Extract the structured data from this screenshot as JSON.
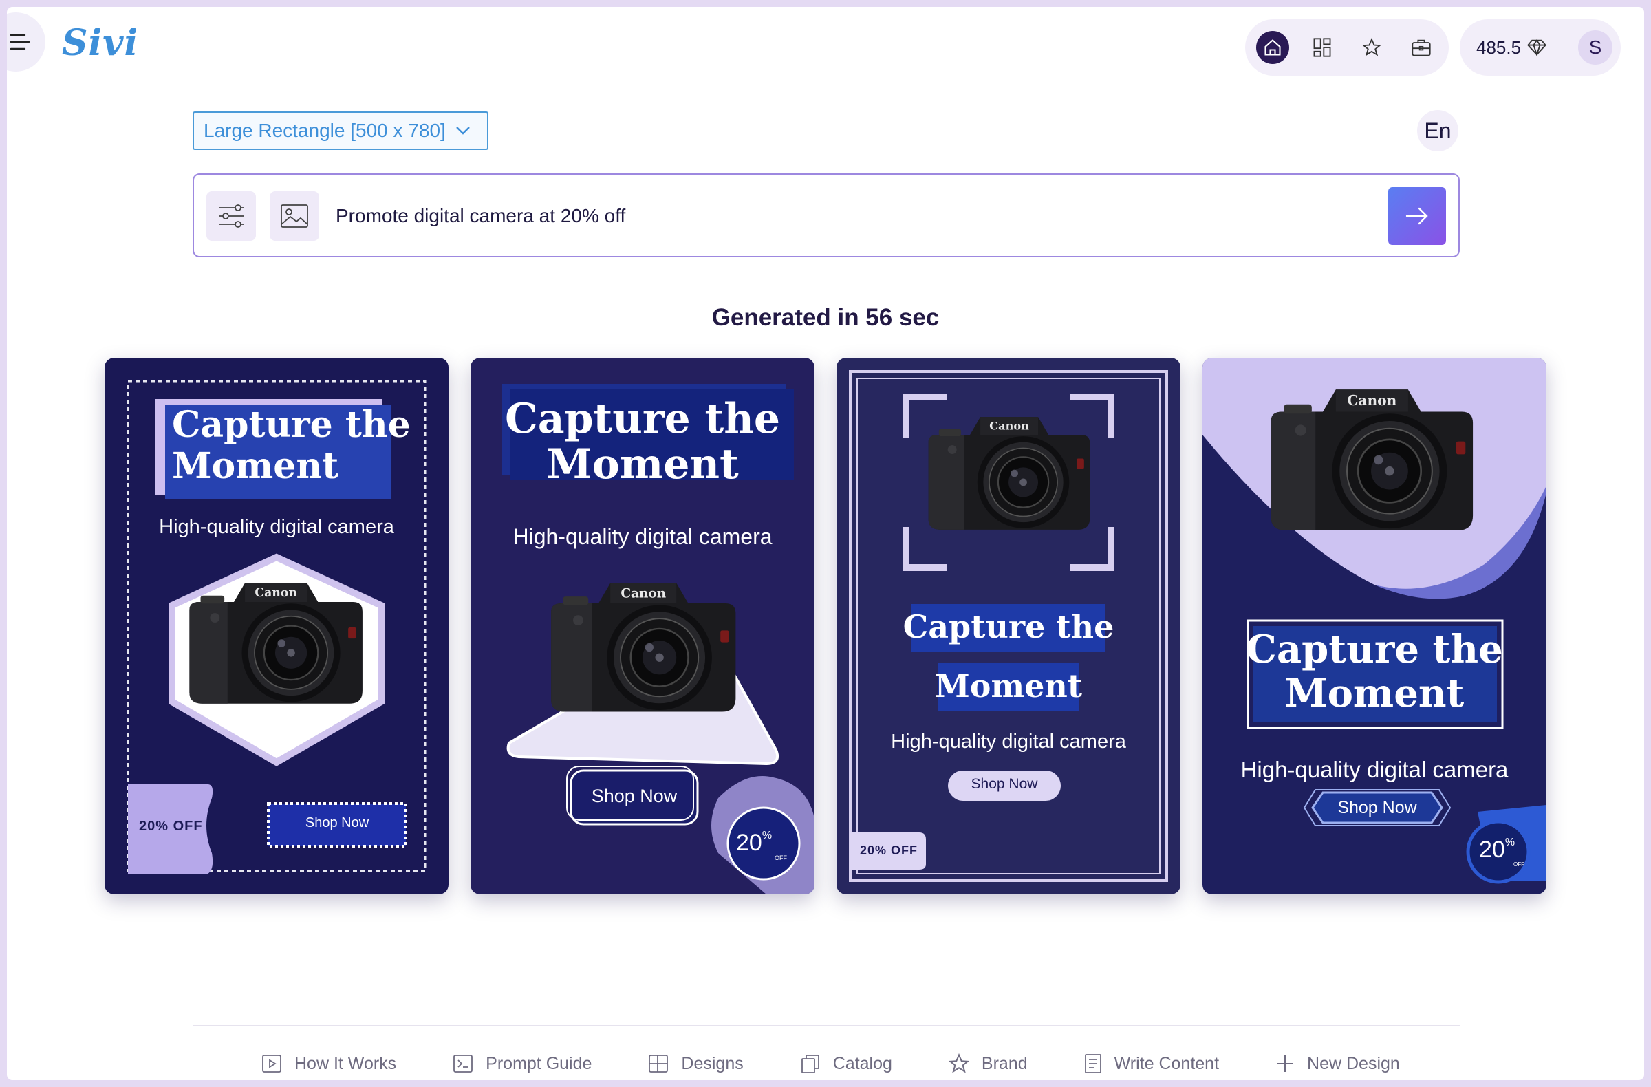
{
  "app": {
    "logo": "Sivi"
  },
  "header": {
    "nav": [
      {
        "icon": "home-icon",
        "active": true
      },
      {
        "icon": "dashboard-icon",
        "active": false
      },
      {
        "icon": "star-icon",
        "active": false
      },
      {
        "icon": "briefcase-icon",
        "active": false
      }
    ],
    "credits": "485.5",
    "credits_icon": "diamond-icon",
    "avatar_initial": "S"
  },
  "controls": {
    "size_select": "Large Rectangle [500 x 780]",
    "language": "En"
  },
  "prompt": {
    "value": "Promote digital camera at 20% off",
    "icons": [
      "settings-sliders-icon",
      "image-icon",
      "arrow-right-icon"
    ]
  },
  "result": {
    "title": "Generated in 56 sec"
  },
  "designs": [
    {
      "headline_1": "Capture the",
      "headline_2": "Moment",
      "subtitle": "High-quality digital camera",
      "discount": "20% OFF",
      "cta": "Shop Now"
    },
    {
      "headline_1": "Capture the",
      "headline_2": "Moment",
      "subtitle": "High-quality digital camera",
      "discount_num": "20",
      "discount_pct": "%",
      "discount_off": "OFF",
      "cta": "Shop Now"
    },
    {
      "headline_1": "Capture the",
      "headline_2": "Moment",
      "subtitle": "High-quality digital camera",
      "discount": "20% OFF",
      "cta": "Shop Now"
    },
    {
      "headline_1": "Capture the",
      "headline_2": "Moment",
      "subtitle": "High-quality digital camera",
      "discount_num": "20",
      "discount_pct": "%",
      "discount_off": "OFF",
      "cta": "Shop Now"
    }
  ],
  "camera": {
    "brand": "Canon"
  },
  "colors": {
    "accent": "#6d5ae6",
    "card_navy": "#1e1b56",
    "lavender": "#c8bff0",
    "royal_blue": "#1d3897"
  },
  "footer": [
    {
      "label": "How It Works",
      "icon": "play-icon"
    },
    {
      "label": "Prompt Guide",
      "icon": "terminal-icon"
    },
    {
      "label": "Designs",
      "icon": "grid-icon"
    },
    {
      "label": "Catalog",
      "icon": "copy-icon"
    },
    {
      "label": "Brand",
      "icon": "star-icon"
    },
    {
      "label": "Write Content",
      "icon": "document-icon"
    },
    {
      "label": "New Design",
      "icon": "plus-icon"
    }
  ]
}
